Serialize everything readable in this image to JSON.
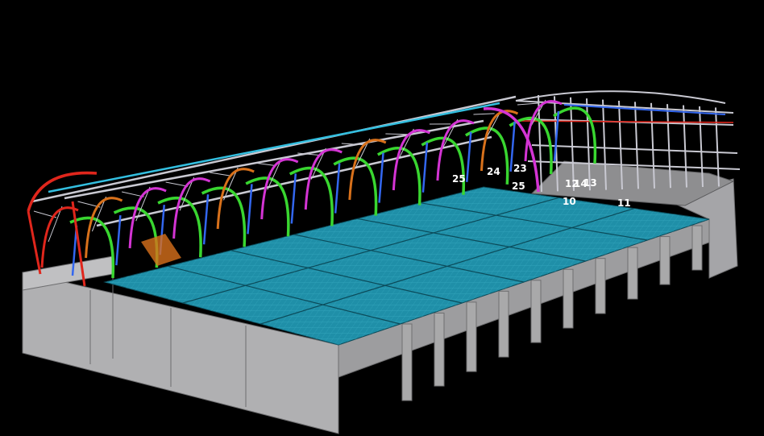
{
  "labels": [
    {
      "id": "l25a",
      "text": "25"
    },
    {
      "id": "l24",
      "text": "24"
    },
    {
      "id": "l23",
      "text": "23"
    },
    {
      "id": "l25b",
      "text": "25"
    },
    {
      "id": "l12",
      "text": "12"
    },
    {
      "id": "l14",
      "text": "14"
    },
    {
      "id": "l13",
      "text": "13"
    },
    {
      "id": "l10",
      "text": "10"
    },
    {
      "id": "l11",
      "text": "11"
    }
  ],
  "colors": {
    "background": "#000000",
    "concrete": "#a9a9aa",
    "concrete_dark": "#8a8a8c",
    "slab": "#1f8fa8",
    "slab_grid": "#46b9cf",
    "arch_green": "#39d630",
    "arch_magenta": "#d434d4",
    "arch_orange": "#d8711b",
    "arch_red": "#e0261c",
    "beam_cyan": "#33bfe0",
    "beam_blue": "#3367f0",
    "truss_grey": "#c9c9d2"
  }
}
